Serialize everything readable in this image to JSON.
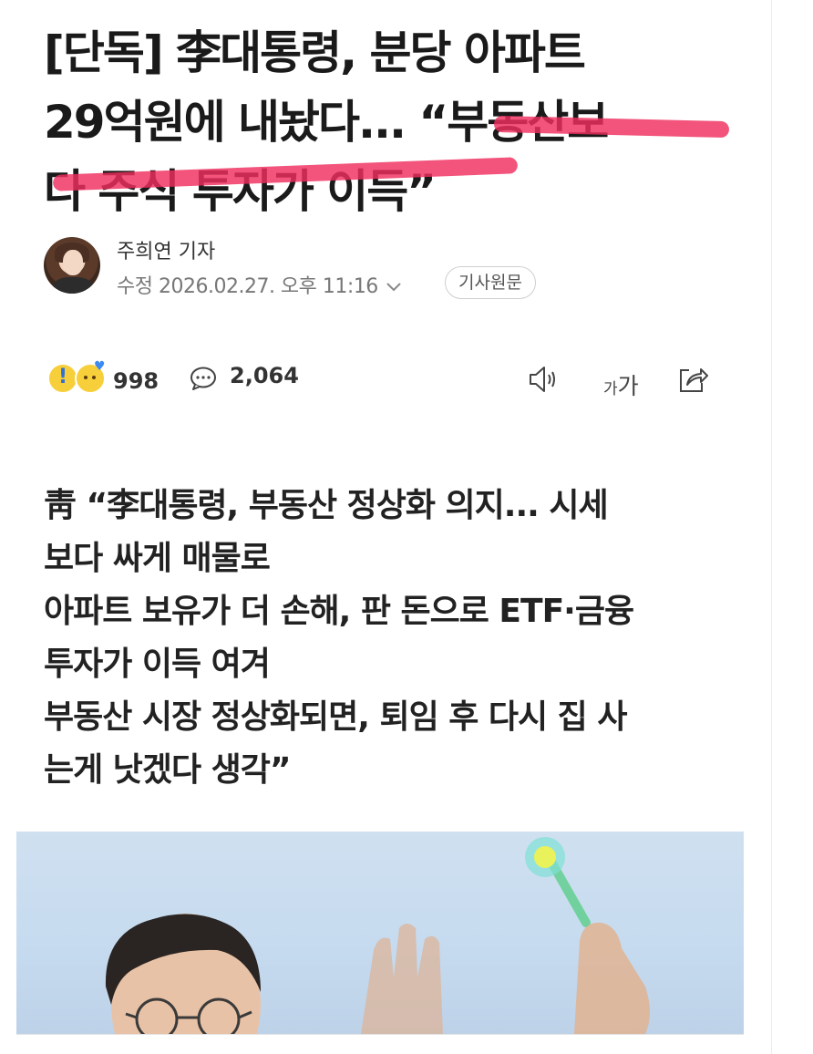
{
  "article": {
    "headline_lines": [
      "[단독] 李대통령, 분당 아파트",
      "29억원에 내놨다... “부동산보",
      "다 주식 투자가 이득”"
    ],
    "author": "주희연 기자",
    "modified_label": "수정",
    "modified_datetime": "2026.02.27. 오후 11:16",
    "original_button": "기사원문",
    "summary_lines": [
      "靑 “李대통령, 부동산 정상화 의지... 시세",
      "보다 싸게 매물로",
      "아파트 보유가 더 손해, 판 돈으로 ETF·금융",
      "투자가 이득 여겨",
      "부동산 시장 정상화되면, 퇴임 후 다시 집 사",
      "는게 낫겠다 생각”"
    ]
  },
  "toolbar": {
    "reaction_count": "998",
    "comment_count": "2,064",
    "font_small_glyph": "가",
    "font_big_glyph": "가"
  },
  "icons": [
    "surprised-emoji-icon",
    "smile-emoji-icon",
    "comment-icon",
    "speaker-icon",
    "font-size-icon",
    "share-icon",
    "chevron-down-icon"
  ],
  "colors": {
    "headline_highlight": "#ef2e5e",
    "text_primary": "#1a1a1a",
    "text_meta": "#777777"
  }
}
